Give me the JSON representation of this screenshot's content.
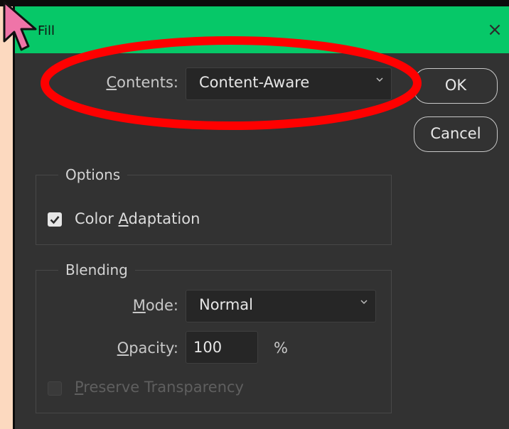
{
  "dialog": {
    "title": "Fill",
    "close_symbol": "×",
    "contents": {
      "label_prefix": "",
      "label_underlined": "C",
      "label_rest": "ontents:",
      "value": "Content-Aware"
    },
    "ok_label": "OK",
    "cancel_label": "Cancel",
    "options": {
      "title": "Options",
      "color_adaptation": {
        "label_prefix": "Color ",
        "label_underlined": "A",
        "label_rest": "daptation",
        "checked": true
      }
    },
    "blending": {
      "title": "Blending",
      "mode": {
        "label_underlined": "M",
        "label_rest": "ode:",
        "value": "Normal"
      },
      "opacity": {
        "label_underlined": "O",
        "label_rest": "pacity:",
        "value": "100",
        "unit": "%"
      },
      "preserve_transparency": {
        "label_underlined": "P",
        "label_rest": "reserve Transparency",
        "checked": false,
        "enabled": false
      }
    }
  },
  "annotation": {
    "shape": "ellipse",
    "color": "#ff0000",
    "target": "contents-field"
  },
  "colors": {
    "titlebar": "#06c868",
    "dialog_bg": "#323232",
    "page_bg": "#fcd9bf"
  },
  "icons": {
    "cursor": "arrow-cursor-icon",
    "close": "close-icon",
    "check": "checkmark-icon",
    "chevron": "chevron-down-icon"
  }
}
